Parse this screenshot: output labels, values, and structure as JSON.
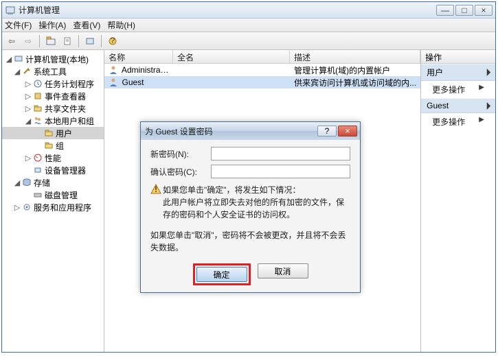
{
  "window": {
    "title": "计算机管理",
    "btn_min": "—",
    "btn_max": "□",
    "btn_close": "×"
  },
  "menu": {
    "file": "文件(F)",
    "action": "操作(A)",
    "view": "查看(V)",
    "help": "帮助(H)"
  },
  "tree": {
    "root": "计算机管理(本地)",
    "system_tools": "系统工具",
    "task_scheduler": "任务计划程序",
    "event_viewer": "事件查看器",
    "shared_folders": "共享文件夹",
    "local_users": "本地用户和组",
    "users": "用户",
    "groups": "组",
    "performance": "性能",
    "device_manager": "设备管理器",
    "storage": "存储",
    "disk_management": "磁盘管理",
    "services": "服务和应用程序"
  },
  "list": {
    "col_name": "名称",
    "col_fullname": "全名",
    "col_desc": "描述",
    "rows": [
      {
        "name": "Administrat...",
        "fullname": "",
        "desc": "管理计算机(域)的内置帐户"
      },
      {
        "name": "Guest",
        "fullname": "",
        "desc": "供来宾访问计算机或访问域的内..."
      }
    ]
  },
  "actions": {
    "title": "操作",
    "section1": "用户",
    "more1": "更多操作",
    "section2": "Guest",
    "more2": "更多操作"
  },
  "dialog": {
    "title": "为 Guest 设置密码",
    "help": "?",
    "close": "×",
    "new_password": "新密码(N):",
    "confirm_password": "确认密码(C):",
    "warning_line1": "如果您单击\"确定\"，将发生如下情况：",
    "warning_line2": "此用户帐户将立即失去对他的所有加密的文件，保存的密码和个人安全证书的访问权。",
    "cancel_info": "如果您单击\"取消\"，密码将不会被更改，并且将不会丢失数据。",
    "ok": "确定",
    "cancel": "取消"
  },
  "icons": {
    "triangle_expanded": "◢",
    "triangle_collapsed": "▷",
    "arrow_right": "▶",
    "arrow_left": "⇦",
    "arrow_fwd": "⇨"
  }
}
